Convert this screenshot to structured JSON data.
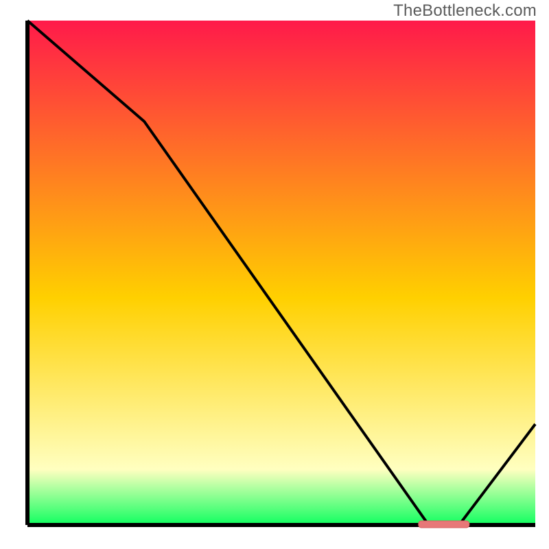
{
  "watermark": "TheBottleneck.com",
  "colors": {
    "gradient_top": "#ff1a4a",
    "gradient_mid": "#ffd000",
    "gradient_low": "#ffffc0",
    "gradient_bottom": "#10ff60",
    "axis": "#000000",
    "curve": "#000000",
    "marker_fill": "#e77878",
    "marker_stroke": "#d46060"
  },
  "chart_data": {
    "type": "line",
    "title": "",
    "xlabel": "",
    "ylabel": "",
    "xlim": [
      0,
      100
    ],
    "ylim": [
      0,
      100
    ],
    "x": [
      0,
      23,
      79,
      85,
      100
    ],
    "y": [
      100,
      80,
      0,
      0,
      20
    ],
    "optimal_band": {
      "x_start": 77,
      "x_end": 87,
      "y": 0
    },
    "notes": "Vertical gradient encodes value from green (0) through yellow/orange to red (100). Black curve descends from top-left, bends around x≈23, reaches the x-axis near x≈79–85, then rises to y≈20 at x=100. A short salmon segment sits on the x-axis marking the minimum."
  }
}
